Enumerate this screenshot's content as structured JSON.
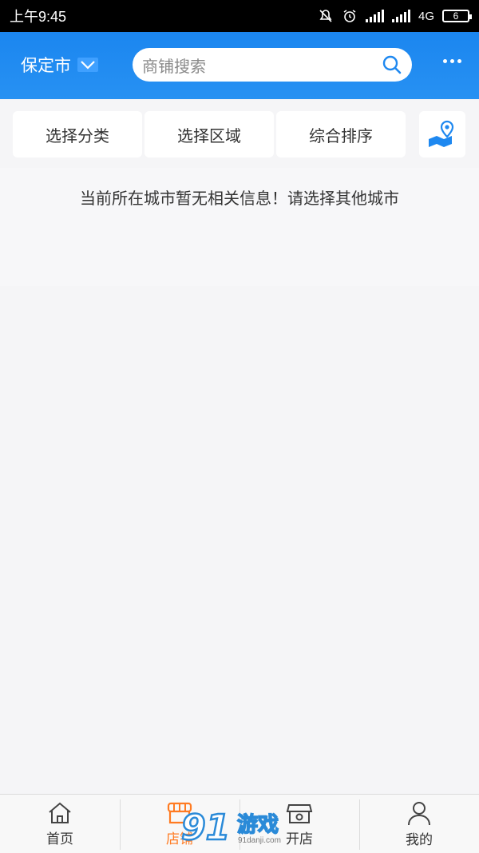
{
  "status_bar": {
    "time": "上午9:45",
    "network": "4G",
    "battery": "6"
  },
  "header": {
    "city": "保定市",
    "search_placeholder": "商铺搜索"
  },
  "filters": [
    {
      "label": "选择分类"
    },
    {
      "label": "选择区域"
    },
    {
      "label": "综合排序"
    }
  ],
  "notice": "当前所在城市暂无相关信息！请选择其他城市",
  "tabbar": [
    {
      "label": "首页",
      "icon": "home-icon"
    },
    {
      "label": "店铺",
      "icon": "store-icon",
      "active": true
    },
    {
      "label": "开店",
      "icon": "open-store-icon"
    },
    {
      "label": "我的",
      "icon": "person-icon"
    }
  ],
  "watermark": {
    "text": "游戏",
    "site": "91danji.com"
  },
  "colors": {
    "brand_blue": "#1e88f0",
    "active_orange": "#ff7b22"
  }
}
